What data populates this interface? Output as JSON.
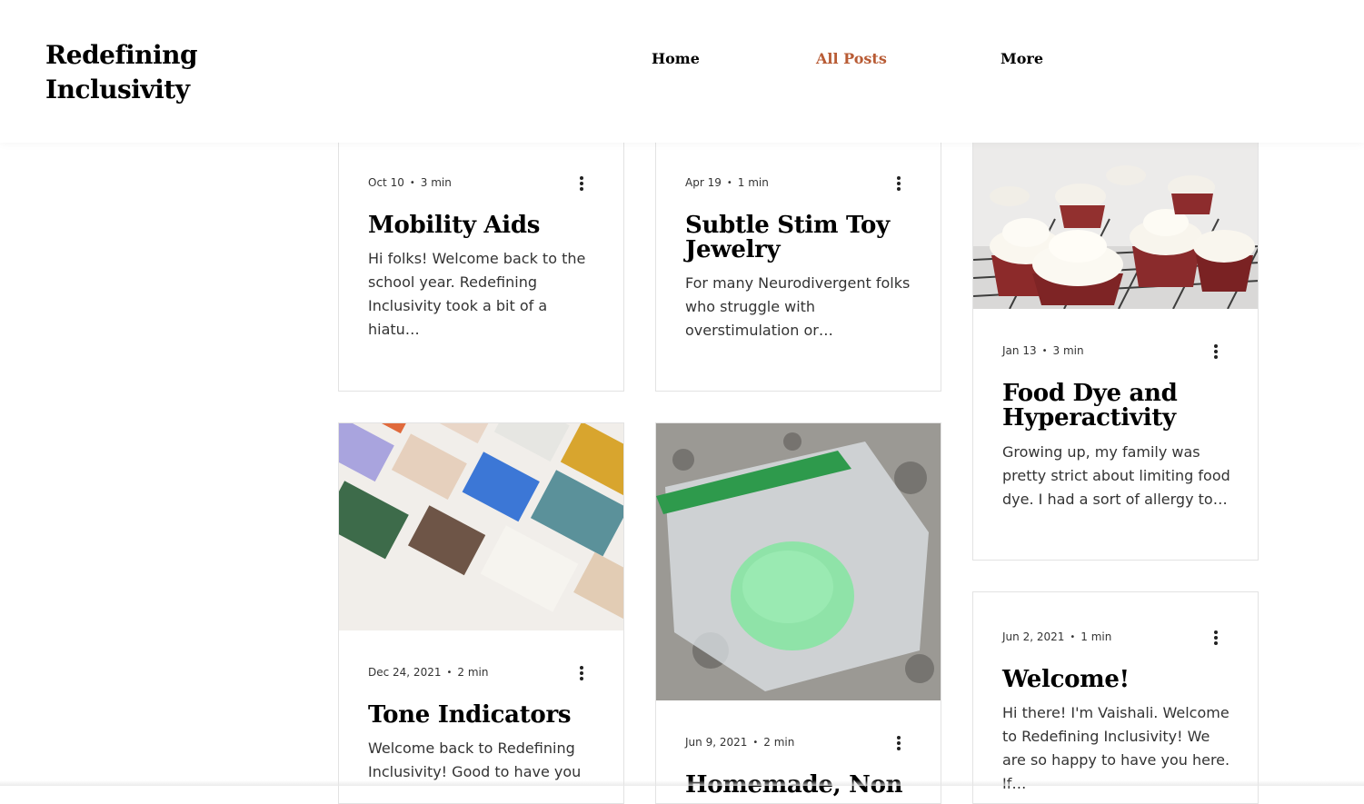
{
  "site": {
    "title_line1": "Redefining",
    "title_line2": "Inclusivity"
  },
  "nav": {
    "home": "Home",
    "all_posts": "All Posts",
    "more": "More",
    "active_color": "#b85b34"
  },
  "posts": [
    {
      "date": "Oct 10",
      "read": "3 min",
      "title": "Mobility Aids",
      "excerpt": "Hi folks! Welcome back to the school year. Redefining Inclusivity took a bit of a hiatu…"
    },
    {
      "date": "Apr 19",
      "read": "1 min",
      "title": "Subtle Stim Toy Jewelry",
      "excerpt": "For many Neurodivergent folks who struggle with overstimulation or…"
    },
    {
      "date": "Jan 13",
      "read": "3 min",
      "title": "Food Dye and Hyperactivity",
      "excerpt": "Growing up, my family was pretty strict about limiting food dye. I had a sort of allergy to…",
      "image": "cupcakes-photo"
    },
    {
      "date": "Dec 24, 2021",
      "read": "2 min",
      "title": "Tone Indicators",
      "excerpt": "Welcome back to Redefining Inclusivity! Good to have you",
      "image": "color-swatches-photo"
    },
    {
      "date": "Jun 9, 2021",
      "read": "2 min",
      "title": "Homemade, Non",
      "image": "playdough-bag-photo"
    },
    {
      "date": "Jun 2, 2021",
      "read": "1 min",
      "title": "Welcome!",
      "excerpt": "Hi there! I'm Vaishali. Welcome to Redefining Inclusivity! We are so happy to have you here. If…"
    }
  ],
  "meta_separator": "•",
  "icons": {
    "post_menu": "more-vertical-icon"
  }
}
